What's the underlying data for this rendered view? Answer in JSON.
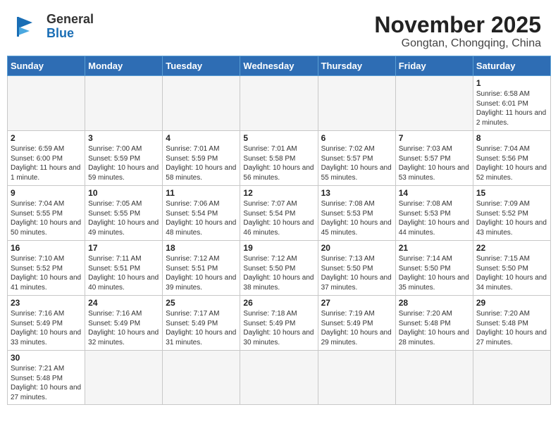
{
  "header": {
    "logo_general": "General",
    "logo_blue": "Blue",
    "month_title": "November 2025",
    "location": "Gongtan, Chongqing, China"
  },
  "days_of_week": [
    "Sunday",
    "Monday",
    "Tuesday",
    "Wednesday",
    "Thursday",
    "Friday",
    "Saturday"
  ],
  "weeks": [
    [
      {
        "num": "",
        "info": ""
      },
      {
        "num": "",
        "info": ""
      },
      {
        "num": "",
        "info": ""
      },
      {
        "num": "",
        "info": ""
      },
      {
        "num": "",
        "info": ""
      },
      {
        "num": "",
        "info": ""
      },
      {
        "num": "1",
        "info": "Sunrise: 6:58 AM\nSunset: 6:01 PM\nDaylight: 11 hours and 2 minutes."
      }
    ],
    [
      {
        "num": "2",
        "info": "Sunrise: 6:59 AM\nSunset: 6:00 PM\nDaylight: 11 hours and 1 minute."
      },
      {
        "num": "3",
        "info": "Sunrise: 7:00 AM\nSunset: 5:59 PM\nDaylight: 10 hours and 59 minutes."
      },
      {
        "num": "4",
        "info": "Sunrise: 7:01 AM\nSunset: 5:59 PM\nDaylight: 10 hours and 58 minutes."
      },
      {
        "num": "5",
        "info": "Sunrise: 7:01 AM\nSunset: 5:58 PM\nDaylight: 10 hours and 56 minutes."
      },
      {
        "num": "6",
        "info": "Sunrise: 7:02 AM\nSunset: 5:57 PM\nDaylight: 10 hours and 55 minutes."
      },
      {
        "num": "7",
        "info": "Sunrise: 7:03 AM\nSunset: 5:57 PM\nDaylight: 10 hours and 53 minutes."
      },
      {
        "num": "8",
        "info": "Sunrise: 7:04 AM\nSunset: 5:56 PM\nDaylight: 10 hours and 52 minutes."
      }
    ],
    [
      {
        "num": "9",
        "info": "Sunrise: 7:04 AM\nSunset: 5:55 PM\nDaylight: 10 hours and 50 minutes."
      },
      {
        "num": "10",
        "info": "Sunrise: 7:05 AM\nSunset: 5:55 PM\nDaylight: 10 hours and 49 minutes."
      },
      {
        "num": "11",
        "info": "Sunrise: 7:06 AM\nSunset: 5:54 PM\nDaylight: 10 hours and 48 minutes."
      },
      {
        "num": "12",
        "info": "Sunrise: 7:07 AM\nSunset: 5:54 PM\nDaylight: 10 hours and 46 minutes."
      },
      {
        "num": "13",
        "info": "Sunrise: 7:08 AM\nSunset: 5:53 PM\nDaylight: 10 hours and 45 minutes."
      },
      {
        "num": "14",
        "info": "Sunrise: 7:08 AM\nSunset: 5:53 PM\nDaylight: 10 hours and 44 minutes."
      },
      {
        "num": "15",
        "info": "Sunrise: 7:09 AM\nSunset: 5:52 PM\nDaylight: 10 hours and 43 minutes."
      }
    ],
    [
      {
        "num": "16",
        "info": "Sunrise: 7:10 AM\nSunset: 5:52 PM\nDaylight: 10 hours and 41 minutes."
      },
      {
        "num": "17",
        "info": "Sunrise: 7:11 AM\nSunset: 5:51 PM\nDaylight: 10 hours and 40 minutes."
      },
      {
        "num": "18",
        "info": "Sunrise: 7:12 AM\nSunset: 5:51 PM\nDaylight: 10 hours and 39 minutes."
      },
      {
        "num": "19",
        "info": "Sunrise: 7:12 AM\nSunset: 5:50 PM\nDaylight: 10 hours and 38 minutes."
      },
      {
        "num": "20",
        "info": "Sunrise: 7:13 AM\nSunset: 5:50 PM\nDaylight: 10 hours and 37 minutes."
      },
      {
        "num": "21",
        "info": "Sunrise: 7:14 AM\nSunset: 5:50 PM\nDaylight: 10 hours and 35 minutes."
      },
      {
        "num": "22",
        "info": "Sunrise: 7:15 AM\nSunset: 5:50 PM\nDaylight: 10 hours and 34 minutes."
      }
    ],
    [
      {
        "num": "23",
        "info": "Sunrise: 7:16 AM\nSunset: 5:49 PM\nDaylight: 10 hours and 33 minutes."
      },
      {
        "num": "24",
        "info": "Sunrise: 7:16 AM\nSunset: 5:49 PM\nDaylight: 10 hours and 32 minutes."
      },
      {
        "num": "25",
        "info": "Sunrise: 7:17 AM\nSunset: 5:49 PM\nDaylight: 10 hours and 31 minutes."
      },
      {
        "num": "26",
        "info": "Sunrise: 7:18 AM\nSunset: 5:49 PM\nDaylight: 10 hours and 30 minutes."
      },
      {
        "num": "27",
        "info": "Sunrise: 7:19 AM\nSunset: 5:49 PM\nDaylight: 10 hours and 29 minutes."
      },
      {
        "num": "28",
        "info": "Sunrise: 7:20 AM\nSunset: 5:48 PM\nDaylight: 10 hours and 28 minutes."
      },
      {
        "num": "29",
        "info": "Sunrise: 7:20 AM\nSunset: 5:48 PM\nDaylight: 10 hours and 27 minutes."
      }
    ],
    [
      {
        "num": "30",
        "info": "Sunrise: 7:21 AM\nSunset: 5:48 PM\nDaylight: 10 hours and 27 minutes."
      },
      {
        "num": "",
        "info": ""
      },
      {
        "num": "",
        "info": ""
      },
      {
        "num": "",
        "info": ""
      },
      {
        "num": "",
        "info": ""
      },
      {
        "num": "",
        "info": ""
      },
      {
        "num": "",
        "info": ""
      }
    ]
  ],
  "colors": {
    "header_bg": "#2e6db4",
    "header_text": "#ffffff",
    "logo_blue": "#1a6eb5",
    "border": "#c8c8c8",
    "empty_bg": "#f5f5f5"
  }
}
